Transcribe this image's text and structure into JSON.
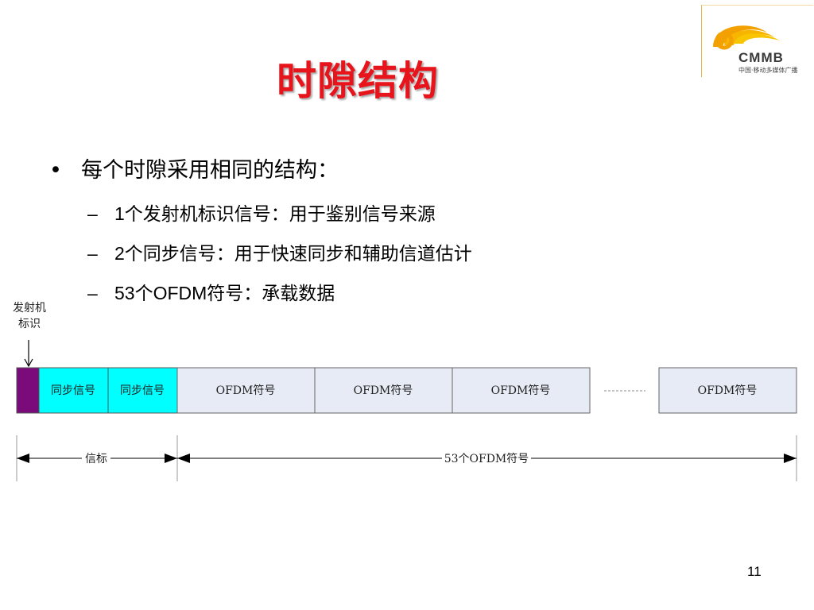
{
  "title": "时隙结构",
  "logo": {
    "name": "CMMB",
    "subtitle": "中国·移动多媒体广播"
  },
  "bullets": {
    "main": "每个时隙采用相同的结构：",
    "subs": [
      "1个发射机标识信号：用于鉴别信号来源",
      "2个同步信号：用于快速同步和辅助信道估计",
      "53个OFDM符号：承载数据"
    ]
  },
  "diagram": {
    "tx_id_label_line1": "发射机",
    "tx_id_label_line2": "标识",
    "blocks": {
      "sync1": "同步信号",
      "sync2": "同步信号",
      "ofdm1": "OFDM符号",
      "ofdm2": "OFDM符号",
      "ofdm3": "OFDM符号",
      "ofdm4": "OFDM符号"
    },
    "beacon_label": "信标",
    "ofdm_span_label": "53个OFDM符号",
    "colors": {
      "tx_id": "#7b0a7b",
      "sync": "#00ffff",
      "ofdm": "#e6ebf5",
      "logo_orange": "#f2a100"
    }
  },
  "page_number": "11"
}
